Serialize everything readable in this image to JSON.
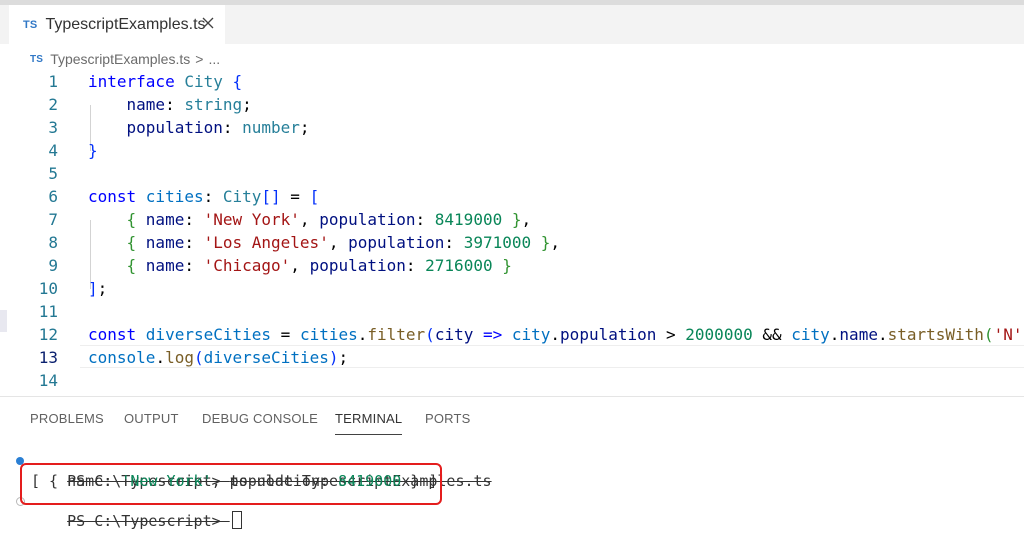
{
  "tab": {
    "badge": "TS",
    "title": "TypescriptExamples.ts"
  },
  "breadcrumb": {
    "badge": "TS",
    "file": "TypescriptExamples.ts",
    "separator": ">",
    "more": "..."
  },
  "editor": {
    "active_line": 13,
    "lines": [
      {
        "n": "1",
        "tokens": [
          [
            "kw",
            "interface "
          ],
          [
            "type",
            "City "
          ],
          [
            "br1",
            "{"
          ]
        ]
      },
      {
        "n": "2",
        "tokens": [
          [
            "op",
            "    "
          ],
          [
            "prop",
            "name"
          ],
          [
            "op",
            ": "
          ],
          [
            "type",
            "string"
          ],
          [
            "op",
            ";"
          ]
        ]
      },
      {
        "n": "3",
        "tokens": [
          [
            "op",
            "    "
          ],
          [
            "prop",
            "population"
          ],
          [
            "op",
            ": "
          ],
          [
            "type",
            "number"
          ],
          [
            "op",
            ";"
          ]
        ]
      },
      {
        "n": "4",
        "tokens": [
          [
            "br1",
            "}"
          ]
        ]
      },
      {
        "n": "5",
        "tokens": []
      },
      {
        "n": "6",
        "tokens": [
          [
            "kw",
            "const "
          ],
          [
            "var",
            "cities"
          ],
          [
            "op",
            ": "
          ],
          [
            "type",
            "City"
          ],
          [
            "br1",
            "[]"
          ],
          [
            "op",
            " = "
          ],
          [
            "br1",
            "["
          ]
        ]
      },
      {
        "n": "7",
        "tokens": [
          [
            "op",
            "    "
          ],
          [
            "br2",
            "{ "
          ],
          [
            "prop",
            "name"
          ],
          [
            "op",
            ": "
          ],
          [
            "str",
            "'New York'"
          ],
          [
            "op",
            ", "
          ],
          [
            "prop",
            "population"
          ],
          [
            "op",
            ": "
          ],
          [
            "num",
            "8419000"
          ],
          [
            "br2",
            " }"
          ],
          [
            "op",
            ","
          ]
        ]
      },
      {
        "n": "8",
        "tokens": [
          [
            "op",
            "    "
          ],
          [
            "br2",
            "{ "
          ],
          [
            "prop",
            "name"
          ],
          [
            "op",
            ": "
          ],
          [
            "str",
            "'Los Angeles'"
          ],
          [
            "op",
            ", "
          ],
          [
            "prop",
            "population"
          ],
          [
            "op",
            ": "
          ],
          [
            "num",
            "3971000"
          ],
          [
            "br2",
            " }"
          ],
          [
            "op",
            ","
          ]
        ]
      },
      {
        "n": "9",
        "tokens": [
          [
            "op",
            "    "
          ],
          [
            "br2",
            "{ "
          ],
          [
            "prop",
            "name"
          ],
          [
            "op",
            ": "
          ],
          [
            "str",
            "'Chicago'"
          ],
          [
            "op",
            ", "
          ],
          [
            "prop",
            "population"
          ],
          [
            "op",
            ": "
          ],
          [
            "num",
            "2716000"
          ],
          [
            "br2",
            " }"
          ]
        ]
      },
      {
        "n": "10",
        "tokens": [
          [
            "br1",
            "]"
          ],
          [
            "op",
            ";"
          ]
        ]
      },
      {
        "n": "11",
        "tokens": []
      },
      {
        "n": "12",
        "tokens": [
          [
            "kw",
            "const "
          ],
          [
            "var",
            "diverseCities"
          ],
          [
            "op",
            " = "
          ],
          [
            "var",
            "cities"
          ],
          [
            "op",
            "."
          ],
          [
            "fn",
            "filter"
          ],
          [
            "br1",
            "("
          ],
          [
            "prop",
            "city"
          ],
          [
            "kw",
            " => "
          ],
          [
            "var",
            "city"
          ],
          [
            "op",
            "."
          ],
          [
            "prop",
            "population"
          ],
          [
            "op",
            " > "
          ],
          [
            "num",
            "2000000"
          ],
          [
            "op",
            " && "
          ],
          [
            "var",
            "city"
          ],
          [
            "op",
            "."
          ],
          [
            "prop",
            "name"
          ],
          [
            "op",
            "."
          ],
          [
            "fn",
            "startsWith"
          ],
          [
            "br2",
            "("
          ],
          [
            "str",
            "'N'"
          ],
          [
            "br2",
            ")"
          ],
          [
            "br1",
            ")"
          ],
          [
            "op",
            ";"
          ]
        ]
      },
      {
        "n": "13",
        "tokens": [
          [
            "var",
            "console"
          ],
          [
            "op",
            "."
          ],
          [
            "fn",
            "log"
          ],
          [
            "br1",
            "("
          ],
          [
            "var",
            "diverseCities"
          ],
          [
            "br1",
            ")"
          ],
          [
            "op",
            ";"
          ]
        ]
      },
      {
        "n": "14",
        "tokens": []
      }
    ]
  },
  "panel": {
    "tabs": [
      "PROBLEMS",
      "OUTPUT",
      "DEBUG CONSOLE",
      "TERMINAL",
      "PORTS"
    ],
    "active_tab": "TERMINAL"
  },
  "terminal": {
    "prompt1": "PS C:\\Typescript> ",
    "command": "ts-node TypescriptExamples.ts",
    "output_tokens": [
      [
        "op",
        "[ { name: "
      ],
      [
        "num",
        "'New York'"
      ],
      [
        "op",
        ", population: "
      ],
      [
        "num",
        "8419000"
      ],
      [
        "op",
        " } ]"
      ]
    ],
    "prompt2": "PS C:\\Typescript> "
  },
  "colors": {
    "accent_blue": "#3178c6",
    "dot_success": "#2a7fd4",
    "highlight_red": "#e41d1d"
  },
  "icons": {
    "tab_close": "close-icon",
    "terminal_status": "circle-dot-icon"
  }
}
